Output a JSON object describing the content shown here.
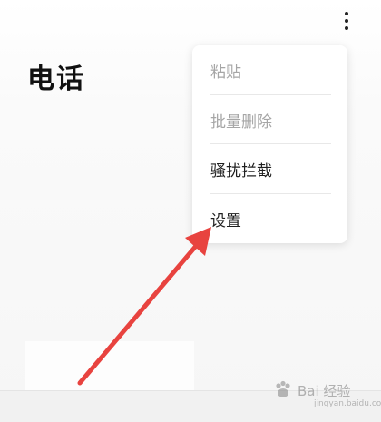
{
  "header": {
    "title": "电话",
    "more_icon": "more-vertical-icon"
  },
  "menu": {
    "items": [
      {
        "label": "粘贴",
        "enabled": false
      },
      {
        "label": "批量删除",
        "enabled": false
      },
      {
        "label": "骚扰拦截",
        "enabled": true
      },
      {
        "label": "设置",
        "enabled": true
      }
    ]
  },
  "annotation": {
    "arrow_color": "#e8433f"
  },
  "watermark": {
    "text": "Bai 经验",
    "sub": "jingyan.baidu.com"
  }
}
